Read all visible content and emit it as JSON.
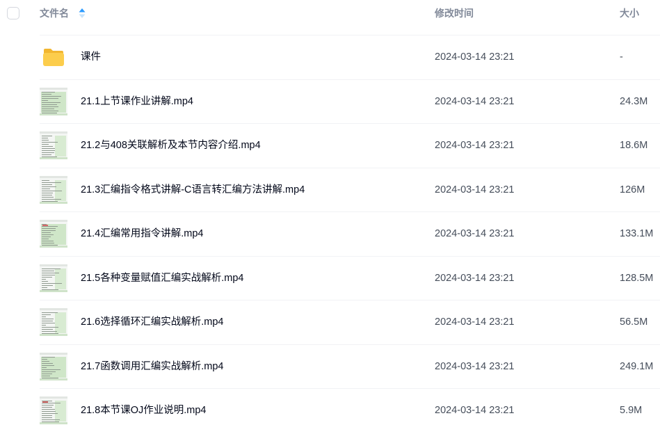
{
  "header": {
    "name_label": "文件名",
    "time_label": "修改时间",
    "size_label": "大小",
    "sort_icon": "sort-ascending-icon"
  },
  "colors": {
    "accent": "#2c9bff",
    "folder": "#f9c940",
    "text_primary": "#03081a",
    "text_secondary": "#818999"
  },
  "files": [
    {
      "name": "课件",
      "time": "2024-03-14 23:21",
      "size": "-",
      "type": "folder",
      "icon": "folder-icon"
    },
    {
      "name": "21.1上节课作业讲解.mp4",
      "time": "2024-03-14 23:21",
      "size": "24.3M",
      "type": "video",
      "icon": "video-thumbnail"
    },
    {
      "name": "21.2与408关联解析及本节内容介绍.mp4",
      "time": "2024-03-14 23:21",
      "size": "18.6M",
      "type": "video",
      "icon": "video-thumbnail"
    },
    {
      "name": "21.3汇编指令格式讲解-C语言转汇编方法讲解.mp4",
      "time": "2024-03-14 23:21",
      "size": "126M",
      "type": "video",
      "icon": "video-thumbnail"
    },
    {
      "name": "21.4汇编常用指令讲解.mp4",
      "time": "2024-03-14 23:21",
      "size": "133.1M",
      "type": "video",
      "icon": "video-thumbnail"
    },
    {
      "name": "21.5各种变量赋值汇编实战解析.mp4",
      "time": "2024-03-14 23:21",
      "size": "128.5M",
      "type": "video",
      "icon": "video-thumbnail"
    },
    {
      "name": "21.6选择循环汇编实战解析.mp4",
      "time": "2024-03-14 23:21",
      "size": "56.5M",
      "type": "video",
      "icon": "video-thumbnail"
    },
    {
      "name": "21.7函数调用汇编实战解析.mp4",
      "time": "2024-03-14 23:21",
      "size": "249.1M",
      "type": "video",
      "icon": "video-thumbnail"
    },
    {
      "name": "21.8本节课OJ作业说明.mp4",
      "time": "2024-03-14 23:21",
      "size": "5.9M",
      "type": "video",
      "icon": "video-thumbnail"
    }
  ]
}
